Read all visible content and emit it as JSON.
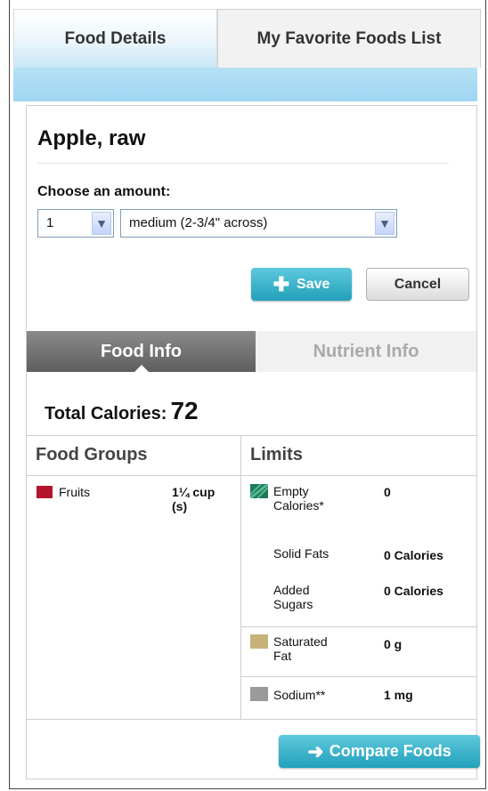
{
  "tabs": {
    "food_details": "Food Details",
    "favorites": "My Favorite Foods List"
  },
  "food": {
    "title": "Apple, raw",
    "amount_label": "Choose an amount:",
    "quantity": "1",
    "unit": "medium (2-3/4\" across)"
  },
  "actions": {
    "save": "Save",
    "cancel": "Cancel",
    "compare": "Compare Foods"
  },
  "subtabs": {
    "food_info": "Food Info",
    "nutrient_info": "Nutrient Info"
  },
  "totals": {
    "label": "Total Calories:",
    "value": "72"
  },
  "food_groups": {
    "header": "Food Groups",
    "items": [
      {
        "name": "Fruits",
        "amount_line1": "1¼ cup",
        "amount_line2": "(s)",
        "color": "#b5152b"
      }
    ]
  },
  "limits": {
    "header": "Limits",
    "empty_calories": {
      "label_line1": "Empty",
      "label_line2": "Calories*",
      "value": "0",
      "color": "#1a7a5a"
    },
    "solid_fats": {
      "label": "Solid Fats",
      "value": "0 Calories"
    },
    "added_sugars": {
      "label_line1": "Added",
      "label_line2": "Sugars",
      "value": "0 Calories"
    },
    "saturated_fat": {
      "label_line1": "Saturated",
      "label_line2": "Fat",
      "value": "0 g",
      "color": "#c8b27a"
    },
    "sodium": {
      "label": "Sodium**",
      "value": "1 mg",
      "color": "#9a9a9a"
    }
  }
}
